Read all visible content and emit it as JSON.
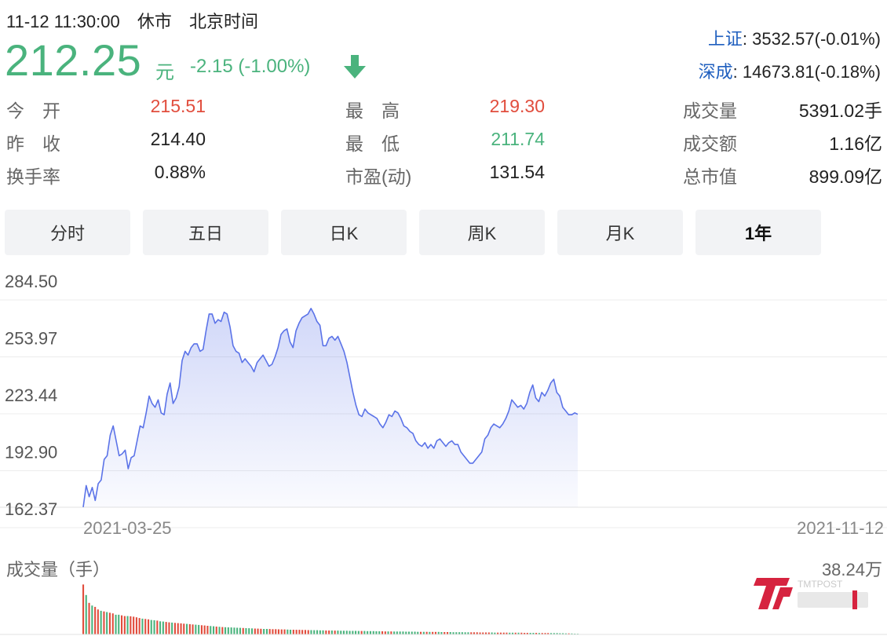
{
  "header": {
    "datetime": "11-12 11:30:00",
    "status": "休市",
    "timezone": "北京时间",
    "price": "212.25",
    "unit": "元",
    "change": "-2.15 (-1.00%)",
    "colors": {
      "down": "#4ab37d",
      "up": "#e14d3d",
      "index_name": "#1f5fbf"
    }
  },
  "indices": [
    {
      "name": "上证",
      "value": ": 3532.57(-0.01%)"
    },
    {
      "name": "深成",
      "value": ": 14673.81(-0.18%)"
    }
  ],
  "stats": [
    {
      "label": "今　开",
      "value": "215.51",
      "color": "up"
    },
    {
      "label": "最　高",
      "value": "219.30",
      "color": "up"
    },
    {
      "label": "成交量",
      "value": "5391.02手",
      "color": "normal"
    },
    {
      "label": "昨　收",
      "value": "214.40",
      "color": "normal"
    },
    {
      "label": "最　低",
      "value": "211.74",
      "color": "down"
    },
    {
      "label": "成交额",
      "value": "1.16亿",
      "color": "normal"
    },
    {
      "label": "换手率",
      "value": "0.88%",
      "color": "normal"
    },
    {
      "label": "市盈(动)",
      "value": "131.54",
      "color": "normal"
    },
    {
      "label": "总市值",
      "value": "899.09亿",
      "color": "normal"
    }
  ],
  "tabs": [
    {
      "label": "分时",
      "active": false
    },
    {
      "label": "五日",
      "active": false
    },
    {
      "label": "日K",
      "active": false
    },
    {
      "label": "周K",
      "active": false
    },
    {
      "label": "月K",
      "active": false
    },
    {
      "label": "1年",
      "active": true
    }
  ],
  "volume": {
    "label": "成交量（手）",
    "max_label": "38.24万",
    "max_value": 382400
  },
  "logo": {
    "text": "TMTPOST",
    "icon": "tmtpost-logo"
  },
  "chart_data": {
    "type": "area",
    "y_ticks": [
      "284.50",
      "253.97",
      "223.44",
      "192.90",
      "162.37"
    ],
    "ylim": [
      162.37,
      284.5
    ],
    "x_tick_labels": [
      "2021-03-25",
      "2021-11-12"
    ],
    "grid": true,
    "line_color": "#5b73e8",
    "series": [
      {
        "values": [
          162.4,
          174,
          168,
          173,
          166,
          175,
          177,
          188,
          190,
          201,
          206,
          198,
          190,
          191,
          193,
          183,
          189,
          190,
          198,
          206,
          205,
          213,
          222,
          218,
          216,
          220,
          213,
          212,
          223,
          229,
          218,
          221,
          227,
          241,
          246,
          244,
          248,
          250,
          250,
          246,
          247,
          257,
          266,
          266,
          261,
          263,
          262,
          267,
          266,
          259,
          249,
          246,
          245,
          240,
          242,
          240,
          238,
          235,
          240,
          242,
          244,
          241,
          238,
          239,
          243,
          248,
          255,
          257,
          258,
          251,
          248,
          257,
          261,
          264,
          265,
          266,
          269,
          266,
          262,
          260,
          249,
          249,
          253,
          254,
          252,
          254,
          250,
          246,
          240,
          232,
          224,
          217,
          212,
          211,
          215,
          213,
          212,
          211,
          210,
          207,
          205,
          208,
          212,
          211,
          214,
          213,
          210,
          206,
          205,
          203,
          202,
          198,
          196,
          195,
          197,
          194,
          196,
          194,
          198,
          199,
          197,
          195,
          197,
          198,
          196,
          196,
          192,
          190,
          188,
          186,
          186,
          188,
          190,
          192,
          199,
          201,
          205,
          207,
          206,
          205,
          207,
          210,
          214,
          220,
          218,
          216,
          217,
          215,
          218,
          224,
          228,
          221,
          219,
          224,
          222,
          225,
          229,
          231,
          224,
          222,
          216,
          214,
          212,
          212,
          213,
          212.25
        ],
        "volume": [
          380000,
          300000,
          240000,
          220000,
          210000,
          190000,
          180000,
          175000,
          170000,
          165000,
          160000,
          150000,
          150000,
          145000,
          140000,
          140000,
          138000,
          135000,
          130000,
          125000,
          120000,
          118000,
          115000,
          110000,
          108000,
          105000,
          100000,
          98000,
          95000,
          92000,
          90000,
          88000,
          86000,
          84000,
          82000,
          80000,
          78000,
          76000,
          74000,
          72000,
          70000,
          68000,
          66000,
          64000,
          62000,
          60000,
          58000,
          56000,
          55000,
          54000,
          53000,
          52000,
          51000,
          50000,
          49000,
          48000,
          47000,
          46000,
          45000,
          44000,
          43000,
          42000,
          42000,
          41000,
          40000,
          40000,
          39000,
          38000,
          38000,
          37000,
          36000,
          36000,
          35000,
          35000,
          34000,
          34000,
          33000,
          33000,
          32000,
          32000,
          31000,
          31000,
          30000,
          30000,
          30000,
          29000,
          29000,
          28000,
          28000,
          28000,
          27000,
          27000,
          27000,
          26000,
          26000,
          26000,
          25000,
          25000,
          25000,
          24000,
          24000,
          24000,
          23000,
          23000,
          23000,
          22000,
          22000,
          22000,
          22000,
          21000,
          21000,
          21000,
          21000,
          20000,
          20000,
          20000,
          20000,
          19000,
          19000,
          19000,
          19000,
          18000,
          18000,
          18000,
          18000,
          17000,
          17000,
          17000,
          17000,
          16000,
          16000,
          16000,
          16000,
          16000,
          15000,
          15000,
          15000,
          15000,
          15000,
          14000,
          14000,
          14000,
          14000,
          14000,
          13000,
          13000,
          13000,
          13000,
          13000,
          12000,
          12000,
          12000,
          12000,
          12000,
          11000,
          11000,
          11000,
          11000,
          10000,
          10000,
          10000,
          9000,
          9000,
          8000,
          8000,
          7000,
          6000,
          5391
        ],
        "volume_up": [
          true,
          false,
          true,
          false,
          true,
          true,
          false,
          true,
          false,
          true,
          true,
          false,
          false,
          true,
          true,
          false,
          true,
          true,
          true,
          true,
          false,
          true,
          true,
          false,
          false,
          true,
          false,
          false,
          true,
          true,
          false,
          true,
          true,
          true,
          true,
          false,
          true,
          true,
          false,
          false,
          true,
          true,
          true,
          false,
          false,
          true,
          false,
          true,
          false,
          false,
          false,
          false,
          false,
          false,
          true,
          false,
          false,
          false,
          true,
          true,
          true,
          false,
          false,
          true,
          true,
          true,
          true,
          true,
          true,
          false,
          false,
          true,
          true,
          true,
          true,
          true,
          true,
          false,
          false,
          false,
          false,
          false,
          true,
          true,
          false,
          true,
          false,
          false,
          false,
          false,
          false,
          false,
          false,
          false,
          true,
          false,
          false,
          false,
          false,
          false,
          false,
          true,
          true,
          false,
          true,
          false,
          false,
          false,
          false,
          false,
          false,
          false,
          false,
          false,
          true,
          false,
          true,
          false,
          true,
          true,
          false,
          false,
          true,
          true,
          false,
          false,
          false,
          false,
          false,
          false,
          false,
          true,
          true,
          true,
          true,
          true,
          true,
          true,
          false,
          false,
          true,
          true,
          true,
          true,
          false,
          false,
          true,
          false,
          true,
          true,
          true,
          false,
          false,
          true,
          false,
          true,
          true,
          true,
          false,
          false,
          false,
          false,
          false,
          false,
          true,
          false
        ]
      }
    ]
  }
}
